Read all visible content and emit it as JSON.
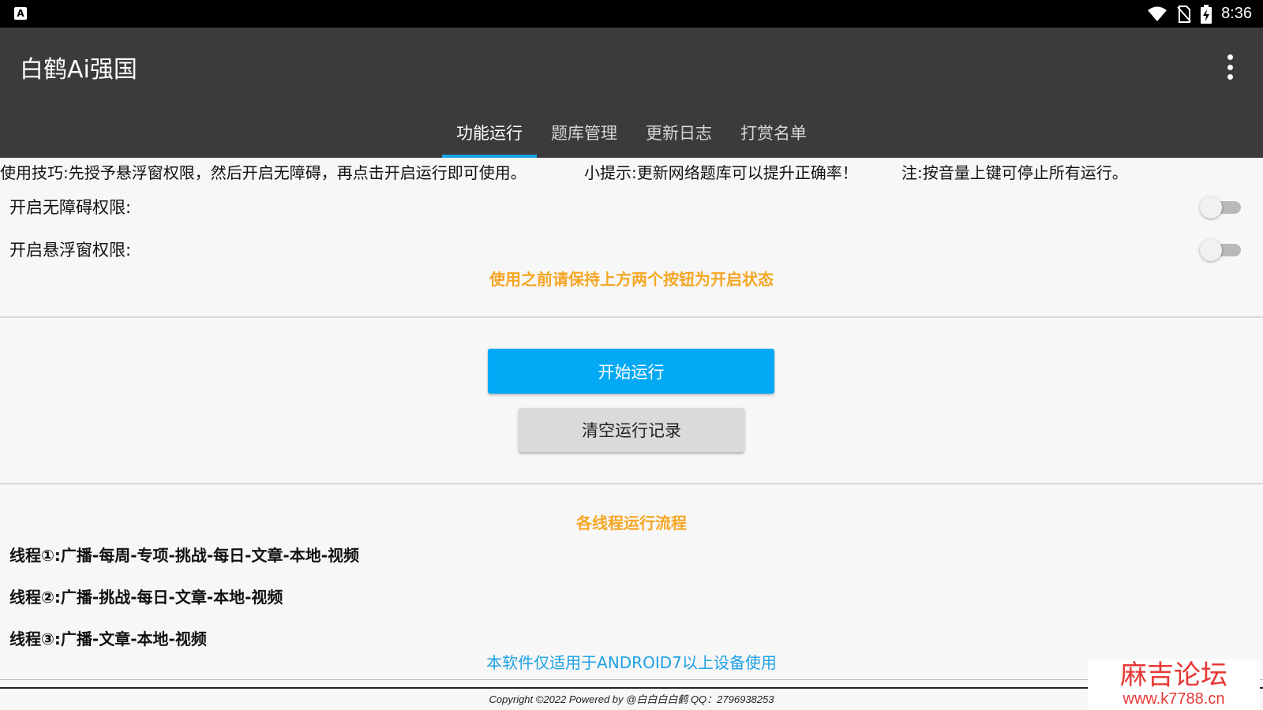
{
  "status_bar": {
    "left_icon": "A",
    "time": "8:36",
    "icons": [
      "wifi-icon",
      "no-sim-icon",
      "battery-charging-icon"
    ]
  },
  "app_bar": {
    "title": "白鹤Ai强国",
    "menu_icon": "overflow-menu-icon",
    "tabs": [
      {
        "label": "功能运行",
        "active": true
      },
      {
        "label": "题库管理",
        "active": false
      },
      {
        "label": "更新日志",
        "active": false
      },
      {
        "label": "打赏名单",
        "active": false
      }
    ]
  },
  "tips": {
    "usage": "使用技巧:先授予悬浮窗权限，然后开启无障碍，再点击开启运行即可使用。",
    "hint": "小提示:更新网络题库可以提升正确率！",
    "note": "注:按音量上键可停止所有运行。"
  },
  "permissions": {
    "accessibility_label": "开启无障碍权限:",
    "accessibility_enabled": false,
    "overlay_label": "开启悬浮窗权限:",
    "overlay_enabled": false,
    "warning": "使用之前请保持上方两个按钮为开启状态"
  },
  "actions": {
    "start_label": "开始运行",
    "clear_label": "清空运行记录"
  },
  "flows": {
    "title": "各线程运行流程",
    "threads": [
      "线程①:广播-每周-专项-挑战-每日-文章-本地-视频",
      "线程②:广播-挑战-每日-文章-本地-视频",
      "线程③:广播-文章-本地-视频"
    ]
  },
  "footer": {
    "android_note": "本软件仅适用于ANDROID7以上设备使用",
    "copyright": "Copyright ©2022  Powered by @白白白白鹤  QQ：2796938253"
  },
  "watermark": {
    "title": "麻吉论坛",
    "url": "www.k7788.cn"
  },
  "colors": {
    "app_bar": "#3b3b3b",
    "tab_indicator": "#1aa3e8",
    "primary_button": "#03a9f4",
    "warning_text": "#f5a623",
    "info_text": "#1da1e6",
    "watermark": "#e53935"
  }
}
